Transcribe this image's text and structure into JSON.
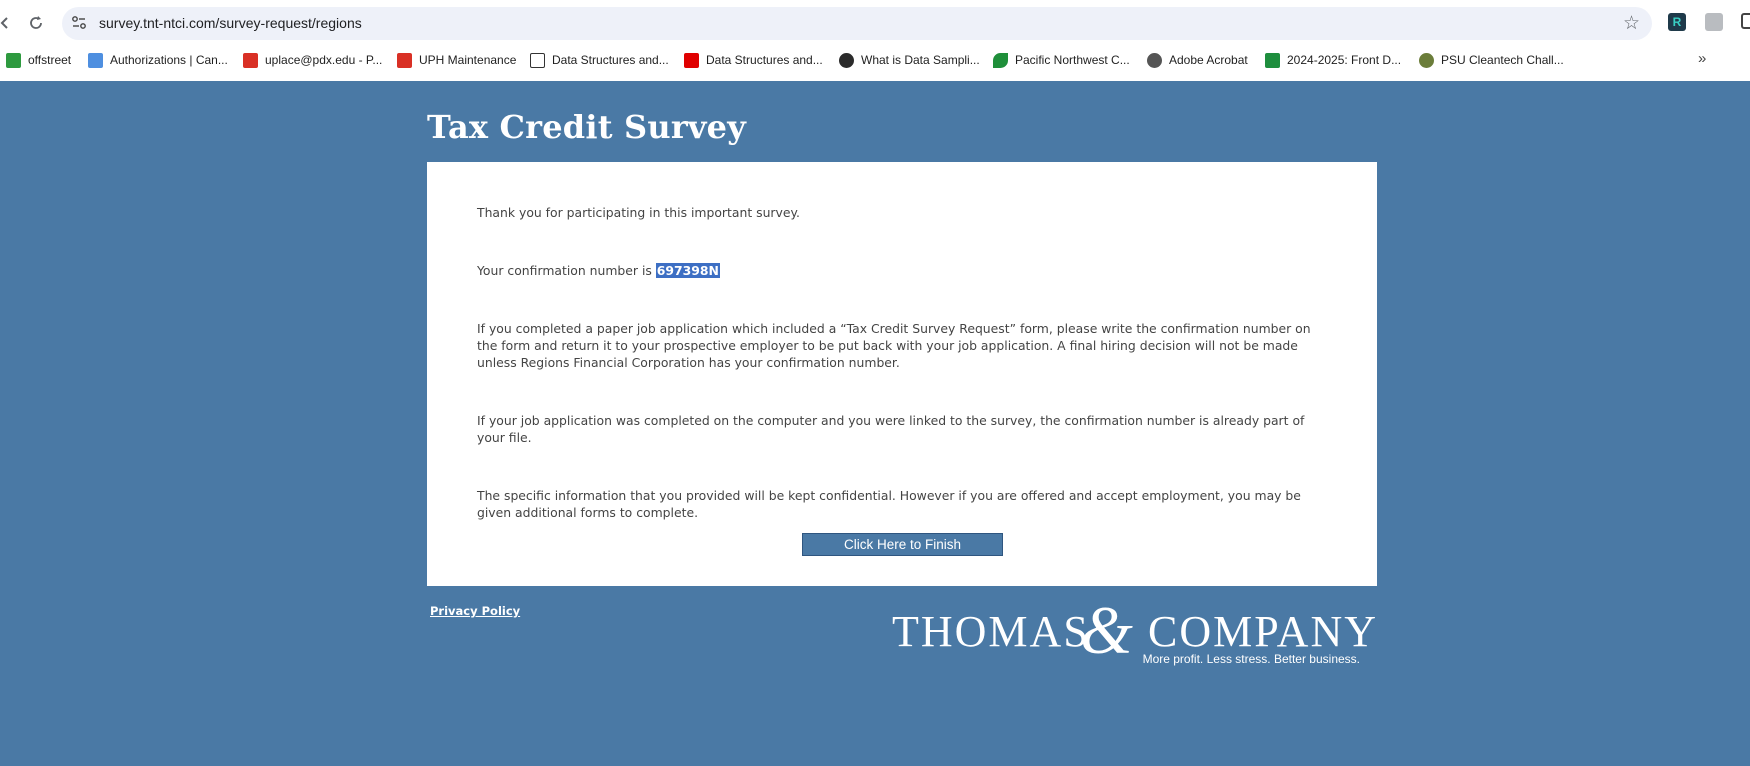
{
  "browser": {
    "url": "survey.tnt-ntci.com/survey-request/regions",
    "bookmarks": [
      {
        "label": "offstreet",
        "icon": "car-icon",
        "color": "#2e9a3f"
      },
      {
        "label": "Authorizations | Can...",
        "icon": "wave-icon",
        "color": "#4e8fe0"
      },
      {
        "label": "uplace@pdx.edu - P...",
        "icon": "gmail-icon",
        "color": "#d93025"
      },
      {
        "label": "UPH Maintenance",
        "icon": "gmail-icon",
        "color": "#d93025"
      },
      {
        "label": "Data Structures and...",
        "icon": "chart-icon",
        "color": "#333333"
      },
      {
        "label": "Data Structures and...",
        "icon": "youtube-icon",
        "color": "#e00000"
      },
      {
        "label": "What is Data Sampli...",
        "icon": "site-icon",
        "color": "#2b2b2b"
      },
      {
        "label": "Pacific Northwest C...",
        "icon": "leaf-icon",
        "color": "#1f8f3a"
      },
      {
        "label": "Adobe Acrobat",
        "icon": "globe-icon",
        "color": "#555555"
      },
      {
        "label": "2024-2025: Front D...",
        "icon": "sheets-icon",
        "color": "#1e8e3e"
      },
      {
        "label": "PSU Cleantech Chall...",
        "icon": "gear-icon",
        "color": "#6b7d3a"
      }
    ]
  },
  "page": {
    "title": "Tax Credit Survey",
    "thanks": "Thank you for participating in this important survey.",
    "confirmation_prefix": "Your confirmation number is ",
    "confirmation_number": "697398N",
    "paper_instructions": "If you completed a paper job application which included a “Tax Credit Survey Request” form, please write the confirmation number on the form and return it to your prospective employer to be put back with your job application. A final hiring decision will not be made unless Regions Financial Corporation has your confirmation number.",
    "computer_instructions": "If your job application was completed on the computer and you were linked to the survey, the confirmation number is already part of your file.",
    "confidential_note": "The specific information that you provided will be kept confidential. However if you are offered and accept employment, you may be given additional forms to complete.",
    "finish_button": "Click Here to Finish",
    "privacy_link": "Privacy Policy"
  },
  "logo": {
    "left_word": "THOMAS",
    "ampersand": "&",
    "right_word": "COMPANY",
    "tagline": "More profit. Less stress. Better business."
  },
  "colors": {
    "page_background": "#4a79a5",
    "selection_highlight": "#3d6fc4"
  }
}
